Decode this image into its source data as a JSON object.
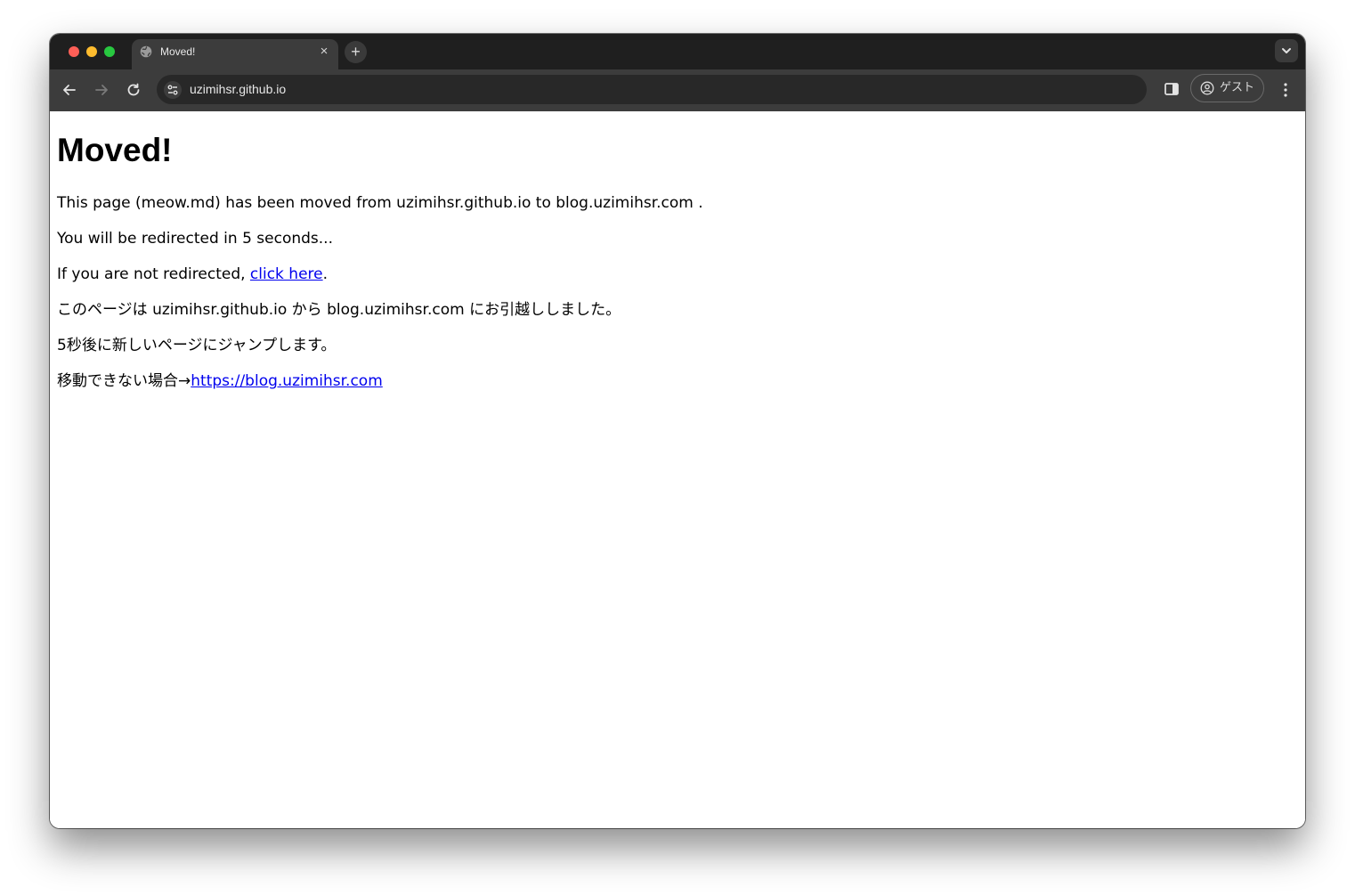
{
  "tab": {
    "title": "Moved!",
    "close_glyph": "×",
    "new_tab_glyph": "+",
    "favicon": "globe-icon"
  },
  "toolbar": {
    "url": "uzimihsr.github.io",
    "profile_label": "ゲスト"
  },
  "page": {
    "heading": "Moved!",
    "line1": "This page (meow.md) has been moved from uzimihsr.github.io to blog.uzimihsr.com .",
    "line2": "You will be redirected in 5 seconds...",
    "line3_prefix": "If you are not redirected, ",
    "line3_link": "click here",
    "line3_suffix": ".",
    "line4": "このページは uzimihsr.github.io から blog.uzimihsr.com にお引越ししました。",
    "line5": "5秒後に新しいページにジャンプします。",
    "line6_prefix": "移動できない場合→",
    "line6_link": "https://blog.uzimihsr.com"
  },
  "colors": {
    "link": "#0000ee",
    "chrome_dark": "#1f1f1f",
    "toolbar": "#3c3c3c"
  }
}
